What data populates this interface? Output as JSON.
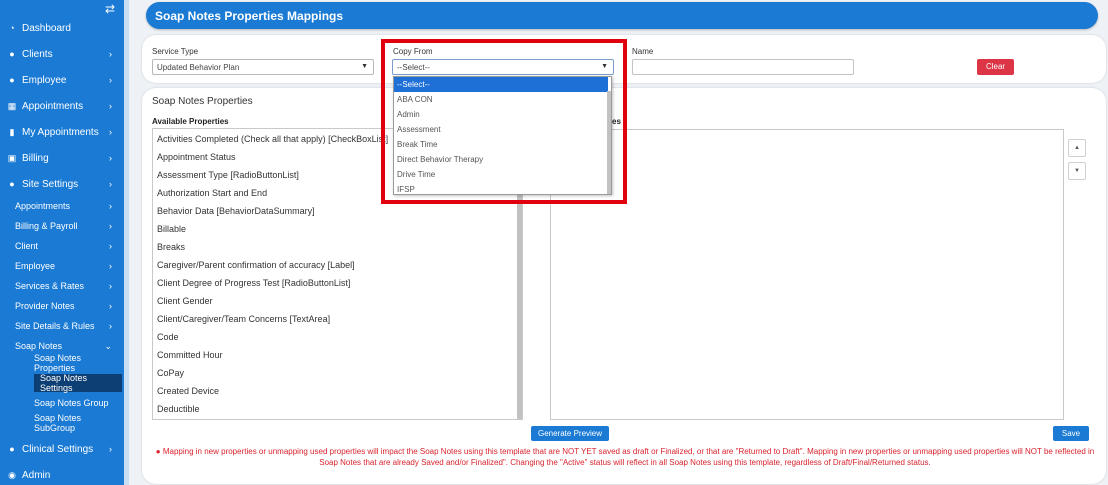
{
  "sidebar": {
    "toggle_icon": "swap-arrows-icon",
    "items": [
      {
        "label": "Dashboard",
        "icon": "dashboard-icon",
        "chevron": false
      },
      {
        "label": "Clients",
        "icon": "user-icon",
        "chevron": true
      },
      {
        "label": "Employee",
        "icon": "users-icon",
        "chevron": true
      },
      {
        "label": "Appointments",
        "icon": "calendar-icon",
        "chevron": true
      },
      {
        "label": "My Appointments",
        "icon": "calendar-check-icon",
        "chevron": true
      },
      {
        "label": "Billing",
        "icon": "money-icon",
        "chevron": true
      },
      {
        "label": "Site Settings",
        "icon": "user-cog-icon",
        "chevron": true
      }
    ],
    "site_settings_children": [
      {
        "label": "Appointments"
      },
      {
        "label": "Billing & Payroll"
      },
      {
        "label": "Client"
      },
      {
        "label": "Employee"
      },
      {
        "label": "Services & Rates"
      },
      {
        "label": "Provider Notes"
      },
      {
        "label": "Site Details & Rules"
      },
      {
        "label": "Soap Notes"
      }
    ],
    "soap_notes_children": [
      {
        "label": "Soap Notes Properties",
        "active": false
      },
      {
        "label": "Soap Notes Settings",
        "active": true
      },
      {
        "label": "Soap Notes Group",
        "active": false
      },
      {
        "label": "Soap Notes SubGroup",
        "active": false
      }
    ],
    "bottom_items": [
      {
        "label": "Clinical Settings",
        "icon": "user-cog-icon",
        "chevron": true
      },
      {
        "label": "Admin",
        "icon": "user-circle-icon",
        "chevron": false
      }
    ]
  },
  "header": {
    "title": "Soap Notes Properties Mappings"
  },
  "filters": {
    "service_type_label": "Service Type",
    "service_type_value": "Updated Behavior Plan",
    "copy_from_label": "Copy From",
    "copy_from_value": "--Select--",
    "name_label": "Name",
    "name_value": "",
    "clear_label": "Clear"
  },
  "copy_from_dropdown": {
    "options": [
      {
        "label": "--Select--",
        "selected": true
      },
      {
        "label": "ABA CON",
        "selected": false
      },
      {
        "label": "Admin",
        "selected": false
      },
      {
        "label": "Assessment",
        "selected": false
      },
      {
        "label": "Break Time",
        "selected": false
      },
      {
        "label": "Direct Behavior Therapy",
        "selected": false
      },
      {
        "label": "Drive Time",
        "selected": false
      },
      {
        "label": "IFSP",
        "selected": false
      }
    ]
  },
  "properties": {
    "section_title": "Soap Notes Properties",
    "available_label": "Available Properties",
    "available": [
      "Activities Completed (Check all that apply) [CheckBoxList]",
      "Appointment Status",
      "Assessment Type [RadioButtonList]",
      "Authorization Start and End",
      "Behavior Data [BehaviorDataSummary]",
      "Billable",
      "Breaks",
      "Caregiver/Parent confirmation of accuracy [Label]",
      "Client Degree of Progress Test [RadioButtonList]",
      "Client Gender",
      "Client/Caregiver/Team Concerns [TextArea]",
      "Code",
      "Committed Hour",
      "CoPay",
      "Created Device",
      "Deductible"
    ],
    "mapped_label_partial": "es",
    "move_up_icon": "triangle-up-icon",
    "move_down_icon": "triangle-down-icon"
  },
  "actions": {
    "generate_preview_label": "Generate Preview",
    "save_label": "Save"
  },
  "warning": {
    "icon": "exclamation-circle-icon",
    "text": "Mapping in new properties or unmapping used properties will impact the Soap Notes using this template that are NOT YET saved as draft or Finalized, or that are \"Returned to Draft\". Mapping in new properties or unmapping used properties will NOT be reflected in Soap Notes that are already Saved and/or Finalized\". Changing the \"Active\" status will reflect in all Soap Notes using this template, regardless of Draft/Final/Returned status."
  },
  "colors": {
    "primary": "#1a7ad4",
    "danger": "#dc3545",
    "highlight": "#e0000e",
    "active_nav": "#0e3f74"
  }
}
